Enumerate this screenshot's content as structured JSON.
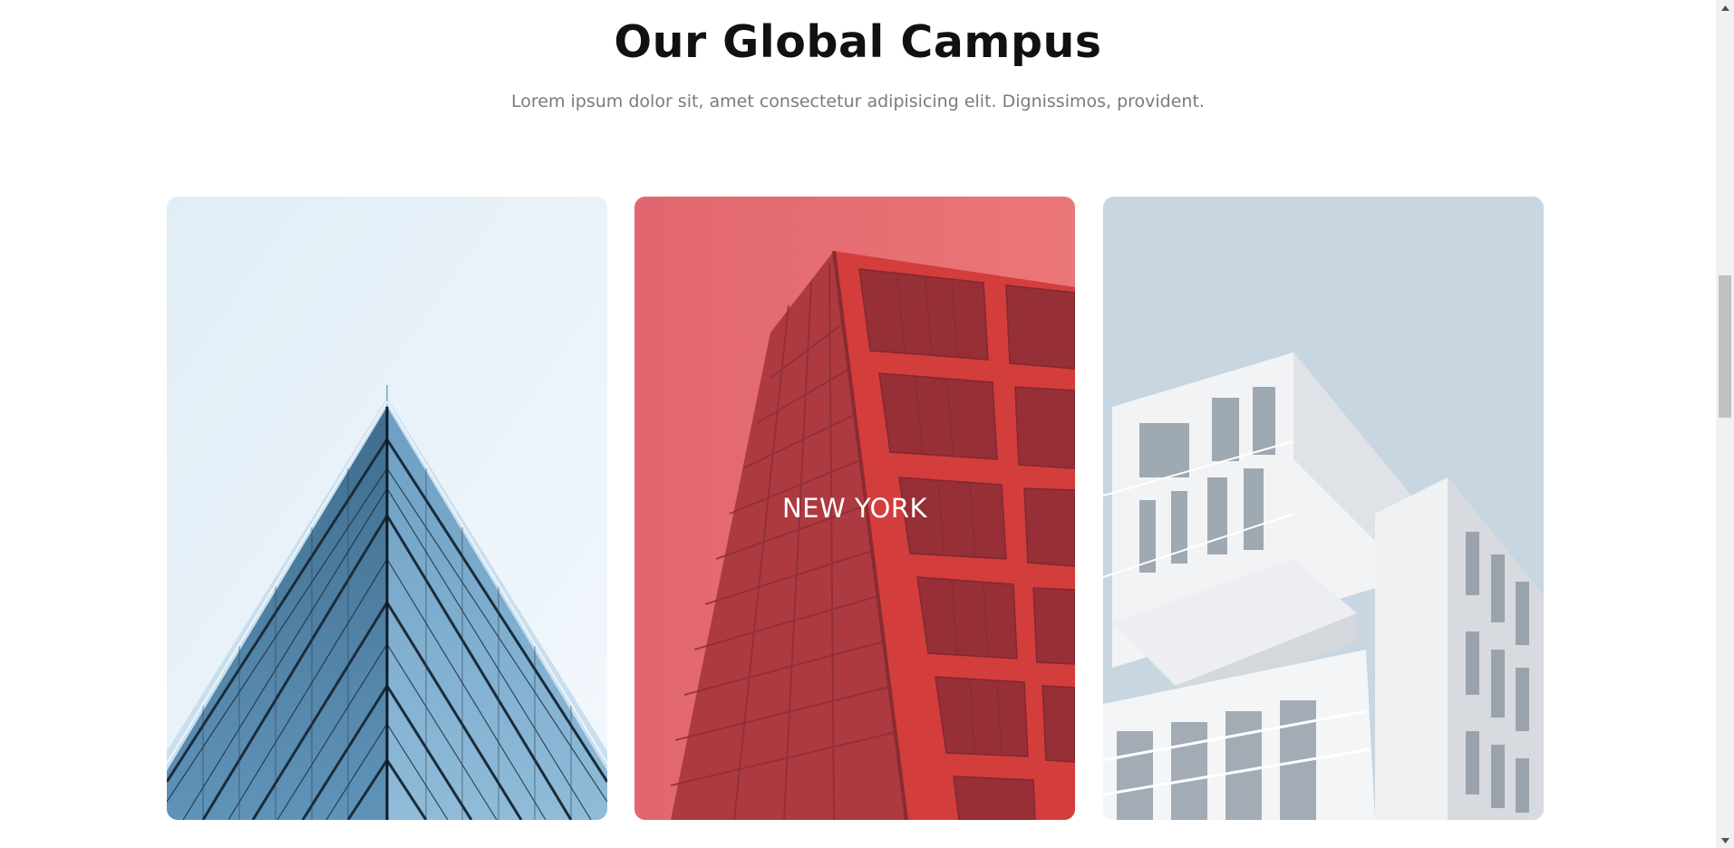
{
  "section": {
    "title": "Our Global Campus",
    "subtitle": "Lorem ipsum dolor sit, amet consectetur adipisicing elit. Dignissimos, provident."
  },
  "campuses": [
    {
      "label": "",
      "image": "glass-pyramid-building-photo"
    },
    {
      "label": "NEW YORK",
      "image": "red-glass-tower-photo",
      "overlay_color": "#e4525b"
    },
    {
      "label": "",
      "image": "white-modular-building-photo"
    }
  ],
  "colors": {
    "heading": "#111111",
    "subtitle": "#7b7b7b",
    "overlay_red": "#e4525b"
  },
  "scrollbar": {
    "up_icon": "scroll-up-arrow-icon",
    "down_icon": "scroll-down-arrow-icon"
  }
}
